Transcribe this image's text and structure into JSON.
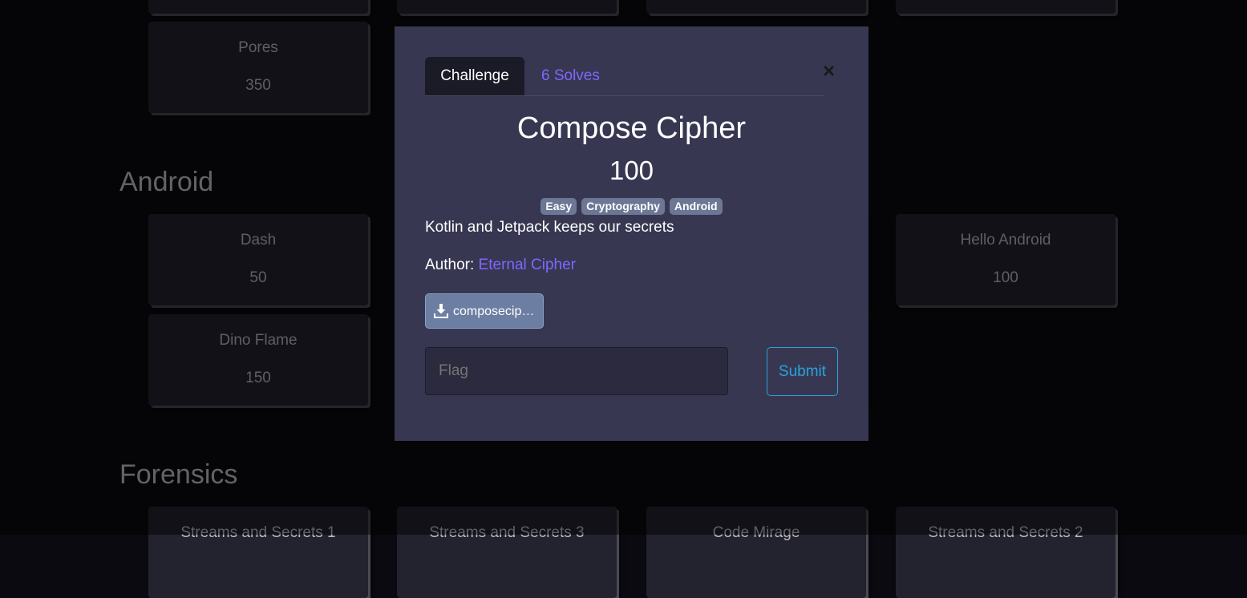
{
  "background": {
    "sections": [
      {
        "name": "Android"
      },
      {
        "name": "Forensics"
      }
    ],
    "cards": [
      {
        "title": "Pores",
        "value": "350"
      },
      {
        "title": "Dash",
        "value": "50"
      },
      {
        "title": "Hello Android",
        "value": "100"
      },
      {
        "title": "Dino Flame",
        "value": "150"
      },
      {
        "title": "Streams and Secrets 1",
        "value": ""
      },
      {
        "title": "Streams and Secrets 3",
        "value": ""
      },
      {
        "title": "Code Mirage",
        "value": ""
      },
      {
        "title": "Streams and Secrets 2",
        "value": ""
      }
    ]
  },
  "modal": {
    "tab_challenge": "Challenge",
    "tab_solves": "6 Solves",
    "close_label": "×",
    "title": "Compose Cipher",
    "value": "100",
    "tags": [
      "Easy",
      "Cryptography",
      "Android"
    ],
    "description": "Kotlin and Jetpack keeps our secrets",
    "author_label": "Author: ",
    "author_name": "Eternal Cipher",
    "file_label": "composecip…",
    "flag_placeholder": "Flag",
    "submit_label": "Submit"
  },
  "colors": {
    "accent": "#7f67ff",
    "submit": "#2aa3d9",
    "tag_bg": "#6c7795",
    "modal_bg": "#383752"
  },
  "icons": {
    "download": "download-icon",
    "close": "close-icon"
  }
}
